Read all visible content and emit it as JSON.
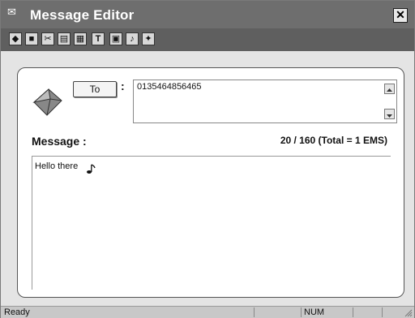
{
  "window": {
    "title": "Message Editor",
    "close_icon": "close-icon",
    "title_icon": "envelope-icon"
  },
  "toolbar": {
    "buttons": [
      {
        "name": "new-icon",
        "glyph": "◆"
      },
      {
        "name": "save-icon",
        "glyph": "■"
      },
      {
        "name": "tools-icon",
        "glyph": "✂"
      },
      {
        "name": "copy-icon",
        "glyph": "▤"
      },
      {
        "name": "paste-icon",
        "glyph": "▦"
      },
      {
        "name": "text-icon",
        "glyph": "T"
      },
      {
        "name": "picture-icon",
        "glyph": "▣"
      },
      {
        "name": "music-icon",
        "glyph": "♪"
      },
      {
        "name": "animation-icon",
        "glyph": "✦"
      }
    ]
  },
  "recipient": {
    "to_label": "To",
    "colon": ":",
    "value": "0135464856465"
  },
  "message": {
    "label": "Message :",
    "counter": "20 / 160 (Total = 1 EMS)",
    "body": "Hello there"
  },
  "status": {
    "ready": "Ready",
    "num": "NUM"
  }
}
